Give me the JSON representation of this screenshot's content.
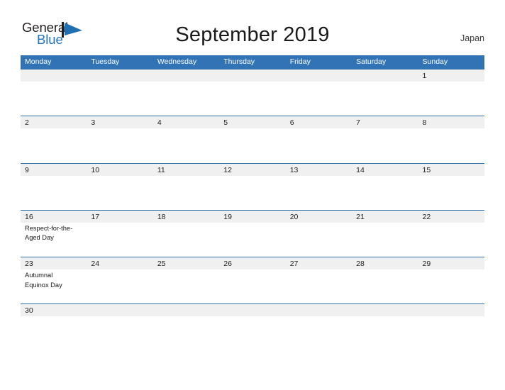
{
  "brand": {
    "name_part1": "General",
    "name_part2": "Blue",
    "mark_icon": "blue-triangle-flag-icon",
    "color_dark": "#231f20",
    "color_blue": "#2274b8"
  },
  "header": {
    "title": "September 2019",
    "country": "Japan",
    "accent_color": "#3173b4",
    "rule_color": "#2e6da4",
    "band_color": "#f0f0f0"
  },
  "weekdays": [
    "Monday",
    "Tuesday",
    "Wednesday",
    "Thursday",
    "Friday",
    "Saturday",
    "Sunday"
  ],
  "weeks": [
    [
      {
        "date": "",
        "event": ""
      },
      {
        "date": "",
        "event": ""
      },
      {
        "date": "",
        "event": ""
      },
      {
        "date": "",
        "event": ""
      },
      {
        "date": "",
        "event": ""
      },
      {
        "date": "",
        "event": ""
      },
      {
        "date": "1",
        "event": ""
      }
    ],
    [
      {
        "date": "2",
        "event": ""
      },
      {
        "date": "3",
        "event": ""
      },
      {
        "date": "4",
        "event": ""
      },
      {
        "date": "5",
        "event": ""
      },
      {
        "date": "6",
        "event": ""
      },
      {
        "date": "7",
        "event": ""
      },
      {
        "date": "8",
        "event": ""
      }
    ],
    [
      {
        "date": "9",
        "event": ""
      },
      {
        "date": "10",
        "event": ""
      },
      {
        "date": "11",
        "event": ""
      },
      {
        "date": "12",
        "event": ""
      },
      {
        "date": "13",
        "event": ""
      },
      {
        "date": "14",
        "event": ""
      },
      {
        "date": "15",
        "event": ""
      }
    ],
    [
      {
        "date": "16",
        "event": "Respect-for-the-Aged Day"
      },
      {
        "date": "17",
        "event": ""
      },
      {
        "date": "18",
        "event": ""
      },
      {
        "date": "19",
        "event": ""
      },
      {
        "date": "20",
        "event": ""
      },
      {
        "date": "21",
        "event": ""
      },
      {
        "date": "22",
        "event": ""
      }
    ],
    [
      {
        "date": "23",
        "event": "Autumnal Equinox Day"
      },
      {
        "date": "24",
        "event": ""
      },
      {
        "date": "25",
        "event": ""
      },
      {
        "date": "26",
        "event": ""
      },
      {
        "date": "27",
        "event": ""
      },
      {
        "date": "28",
        "event": ""
      },
      {
        "date": "29",
        "event": ""
      }
    ],
    [
      {
        "date": "30",
        "event": ""
      },
      {
        "date": "",
        "event": ""
      },
      {
        "date": "",
        "event": ""
      },
      {
        "date": "",
        "event": ""
      },
      {
        "date": "",
        "event": ""
      },
      {
        "date": "",
        "event": ""
      },
      {
        "date": "",
        "event": ""
      }
    ]
  ]
}
